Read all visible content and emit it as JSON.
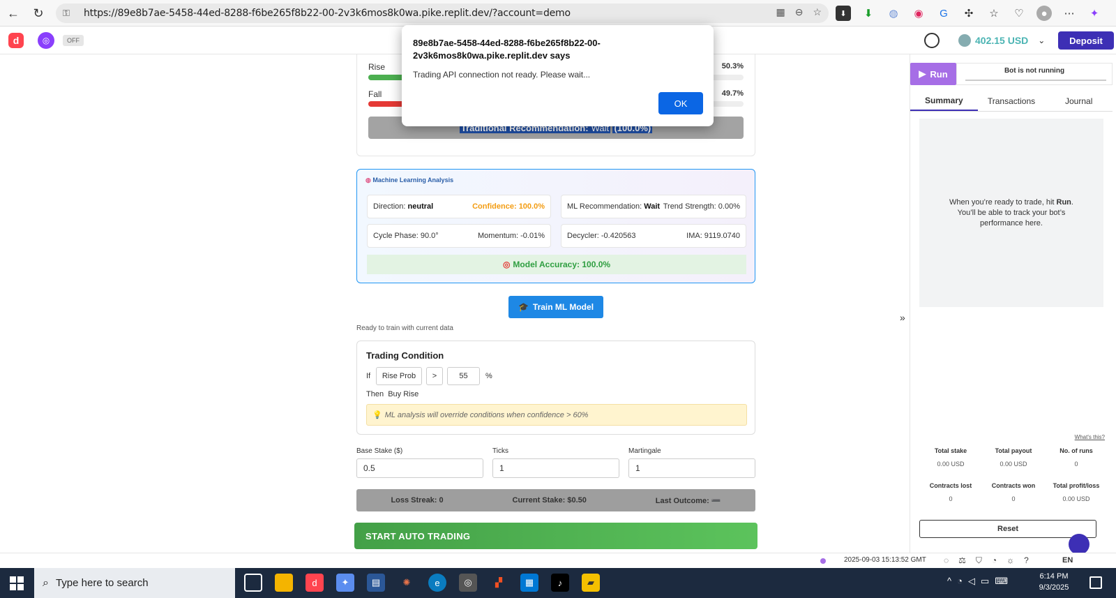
{
  "browser": {
    "url": "https://89e8b7ae-5458-44ed-8288-f6be265f8b22-00-2v3k6mos8k0wa.pike.replit.dev/?account=demo"
  },
  "header": {
    "toggle_label": "OFF",
    "balance": "402.15 USD",
    "deposit_label": "Deposit"
  },
  "probabilities": {
    "rise_label": "Rise",
    "rise_pct": "50.3%",
    "rise_value": 50.3,
    "fall_label": "Fall",
    "fall_pct": "49.7%",
    "fall_value": 49.7,
    "recommendation_label": "Traditional Recommendation:",
    "recommendation_value": "Wait",
    "recommendation_pct": "(100.0%)"
  },
  "ml": {
    "title": "Machine Learning Analysis",
    "direction_label": "Direction:",
    "direction_value": "neutral",
    "confidence": "Confidence: 100.0%",
    "recommendation_label": "ML Recommendation:",
    "recommendation_value": "Wait",
    "trend_strength": "Trend Strength: 0.00%",
    "cycle_phase": "Cycle Phase: 90.0°",
    "momentum": "Momentum: -0.01%",
    "decycler": "Decycler: -0.420563",
    "ima": "IMA: 9119.0740",
    "accuracy": "Model Accuracy: 100.0%"
  },
  "train": {
    "button_label": "Train ML Model",
    "status": "Ready to train with current data"
  },
  "condition": {
    "title": "Trading Condition",
    "if_label": "If",
    "field": "Rise Prob",
    "operator": ">",
    "threshold": "55",
    "unit": "%",
    "then_label": "Then",
    "action": "Buy Rise",
    "note": "ML analysis will override conditions when confidence > 60%"
  },
  "settings": {
    "base_stake_label": "Base Stake ($)",
    "base_stake_value": "0.5",
    "ticks_label": "Ticks",
    "ticks_value": "1",
    "martingale_label": "Martingale",
    "martingale_value": "1"
  },
  "stats": {
    "loss_streak": "Loss Streak: 0",
    "current_stake": "Current Stake: $0.50",
    "last_outcome": "Last Outcome: ➖"
  },
  "start_label": "START AUTO TRADING",
  "bot": {
    "run_label": "Run",
    "status": "Bot is not running",
    "tabs": [
      "Summary",
      "Transactions",
      "Journal"
    ],
    "summary_text_1": "When you’re ready to trade, hit ",
    "summary_text_run": "Run",
    "summary_text_2": ". You’ll be able to track your bot’s performance here.",
    "whats_this": "What's this?",
    "stats": [
      {
        "label": "Total stake",
        "value": "0.00 USD"
      },
      {
        "label": "Total payout",
        "value": "0.00 USD"
      },
      {
        "label": "No. of runs",
        "value": "0"
      },
      {
        "label": "Contracts lost",
        "value": "0"
      },
      {
        "label": "Contracts won",
        "value": "0"
      },
      {
        "label": "Total profit/loss",
        "value": "0.00 USD"
      }
    ],
    "reset_label": "Reset"
  },
  "footer": {
    "timestamp": "2025-09-03 15:13:52 GMT",
    "language": "EN"
  },
  "dialog": {
    "title": "89e8b7ae-5458-44ed-8288-f6be265f8b22-00-2v3k6mos8k0wa.pike.replit.dev says",
    "message": "Trading API connection not ready. Please wait...",
    "ok_label": "OK"
  },
  "taskbar": {
    "search_placeholder": "Type here to search",
    "time": "6:14 PM",
    "date": "9/3/2025"
  },
  "colors": {
    "rise_bar": "#4caf50",
    "fall_bar": "#e53935",
    "deposit": "#3d2fb5",
    "train_button": "#1e88e5",
    "start_button": "#43a047",
    "run_button": "#a66ee6"
  }
}
